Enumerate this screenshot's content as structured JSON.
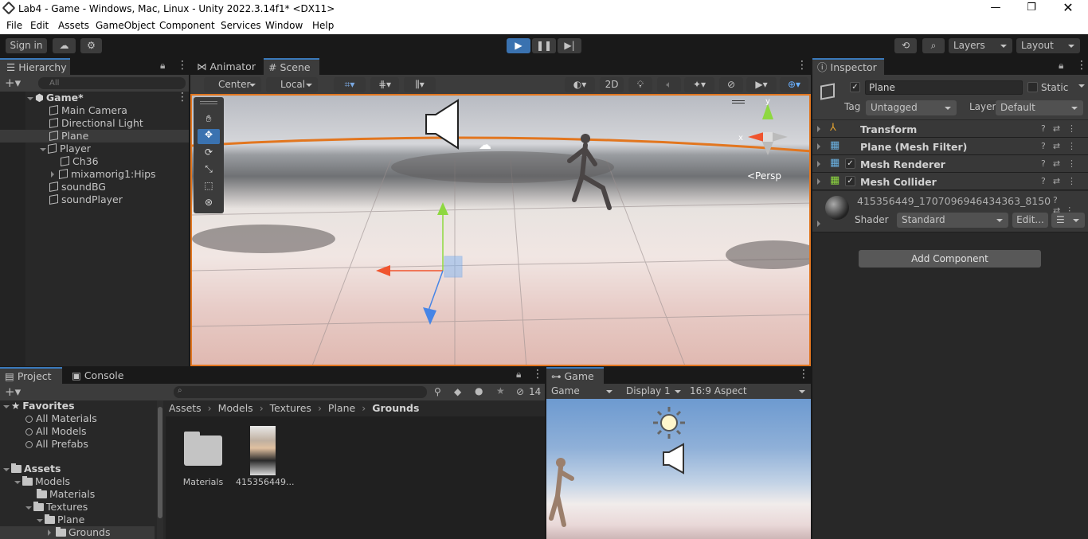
{
  "window": {
    "title": "Lab4 - Game - Windows, Mac, Linux - Unity 2022.3.14f1* <DX11>"
  },
  "menu": [
    "File",
    "Edit",
    "Assets",
    "GameObject",
    "Component",
    "Services",
    "Window",
    "Help"
  ],
  "toolbar": {
    "sign_in": "Sign in",
    "layers": "Layers",
    "layout": "Layout"
  },
  "hierarchy": {
    "tab": "Hierarchy",
    "search_placeholder": "All",
    "scene": "Game*",
    "items": [
      "Main Camera",
      "Directional Light",
      "Plane",
      "Player",
      "Ch36",
      "mixamorig1:Hips",
      "soundBG",
      "soundPlayer"
    ]
  },
  "scene_view": {
    "tabs": [
      "Animator",
      "Scene"
    ],
    "pivot": "Center",
    "space": "Local",
    "mode_2d": "2D",
    "persp_label": "<Persp",
    "gizmo_y": "y",
    "gizmo_x": "x"
  },
  "inspector": {
    "tab": "Inspector",
    "object_name": "Plane",
    "static_label": "Static",
    "tag_label": "Tag",
    "tag_value": "Untagged",
    "layer_label": "Layer",
    "layer_value": "Default",
    "components": [
      "Transform",
      "Plane (Mesh Filter)",
      "Mesh Renderer",
      "Mesh Collider"
    ],
    "material_name": "415356449_1707096946434363_8150",
    "shader_label": "Shader",
    "shader_value": "Standard",
    "edit_button": "Edit...",
    "add_component": "Add Component"
  },
  "project": {
    "tabs": [
      "Project",
      "Console"
    ],
    "hidden_count": "14",
    "favorites_label": "Favorites",
    "favorites": [
      "All Materials",
      "All Models",
      "All Prefabs"
    ],
    "assets_label": "Assets",
    "tree": [
      "Models",
      "Materials",
      "Textures",
      "Plane",
      "Grounds"
    ],
    "breadcrumb": [
      "Assets",
      "Models",
      "Textures",
      "Plane",
      "Grounds"
    ],
    "files": [
      "Materials",
      "415356449..."
    ]
  },
  "game_view": {
    "tab": "Game",
    "mode": "Game",
    "display": "Display 1",
    "aspect": "16:9 Aspect"
  }
}
